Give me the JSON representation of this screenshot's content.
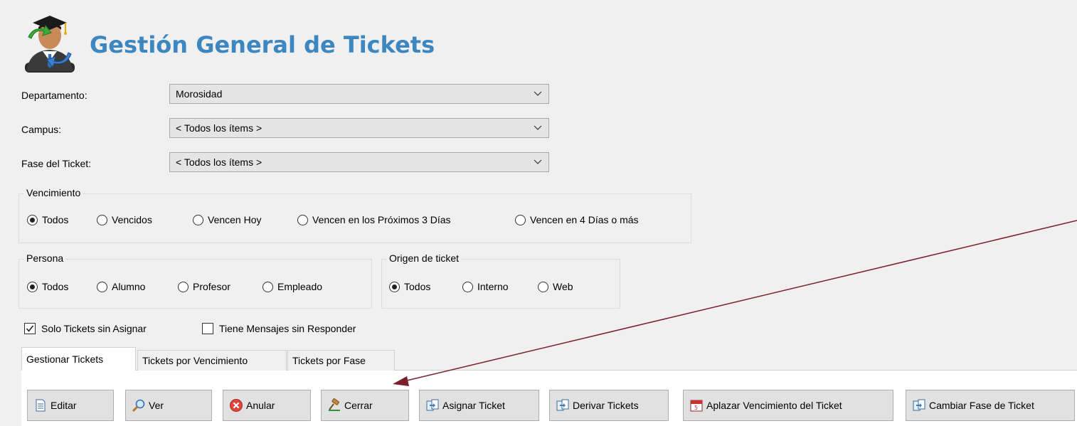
{
  "header": {
    "title": "Gestión General de Tickets",
    "icon": "graduate-user-icon"
  },
  "filters": {
    "departamento": {
      "label": "Departamento:",
      "value": "Morosidad"
    },
    "campus": {
      "label": "Campus:",
      "value": "< Todos los ítems >"
    },
    "fase": {
      "label": "Fase del Ticket:",
      "value": "< Todos los ítems >"
    }
  },
  "vencimiento": {
    "title": "Vencimiento",
    "options": [
      "Todos",
      "Vencidos",
      "Vencen Hoy",
      "Vencen en los Próximos 3 Días",
      "Vencen en 4 Días o más"
    ],
    "selected": "Todos"
  },
  "persona": {
    "title": "Persona",
    "options": [
      "Todos",
      "Alumno",
      "Profesor",
      "Empleado"
    ],
    "selected": "Todos"
  },
  "origen": {
    "title": "Origen de ticket",
    "options": [
      "Todos",
      "Interno",
      "Web"
    ],
    "selected": "Todos"
  },
  "checks": [
    {
      "label": "Solo Tickets sin Asignar",
      "checked": true
    },
    {
      "label": "Tiene Mensajes sin Responder",
      "checked": false
    }
  ],
  "tabs": [
    "Gestionar Tickets",
    "Tickets por Vencimiento",
    "Tickets por Fase"
  ],
  "active_tab": "Gestionar Tickets",
  "toolbar": {
    "buttons": [
      {
        "label": "Editar",
        "icon": "document-icon"
      },
      {
        "label": "Ver",
        "icon": "magnifier-icon"
      },
      {
        "label": "Anular",
        "icon": "cancel-icon"
      },
      {
        "label": "Cerrar",
        "icon": "gavel-icon"
      },
      {
        "label": "Asignar Ticket",
        "icon": "documents-icon"
      },
      {
        "label": "Derivar Tickets",
        "icon": "documents-icon"
      },
      {
        "label": "Aplazar Vencimiento del Ticket",
        "icon": "calendar-icon"
      },
      {
        "label": "Cambiar Fase de Ticket",
        "icon": "documents-icon"
      }
    ]
  },
  "colors": {
    "title": "#3c87bf",
    "annotation_arrow": "#7a1f2b"
  }
}
